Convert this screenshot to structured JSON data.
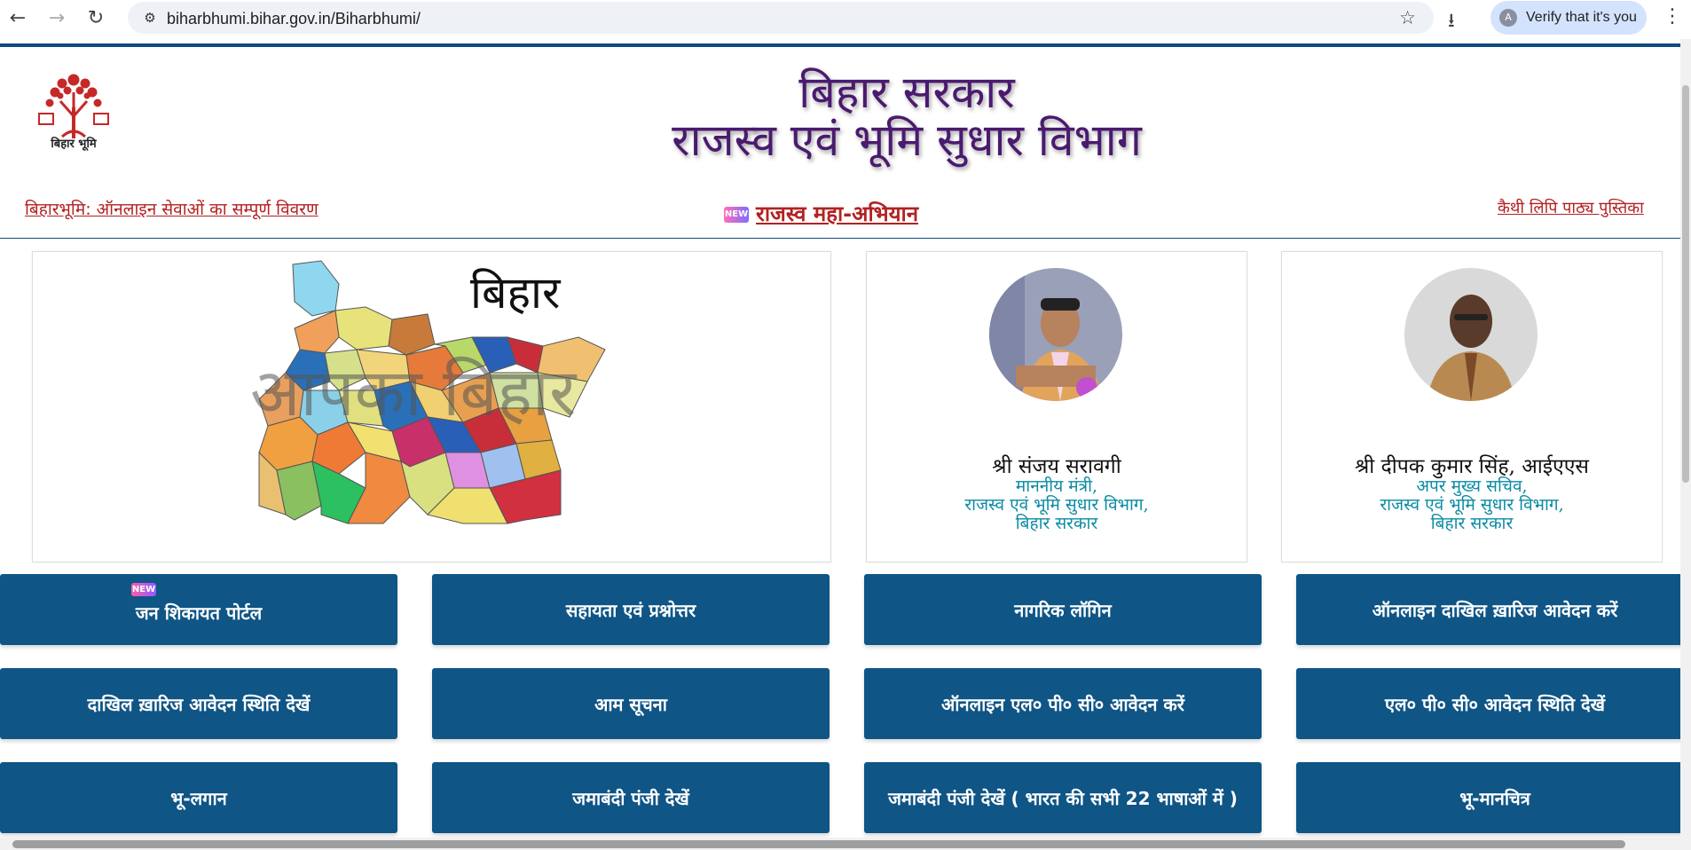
{
  "browser": {
    "url": "biharbhumi.bihar.gov.in/Biharbhumi/",
    "verify_label": "Verify that it's you",
    "avatar_letter": "A"
  },
  "header": {
    "logo_text": "बिहार भूमि",
    "title_line1": "बिहार सरकार",
    "title_line2": "राजस्व एवं भूमि सुधार विभाग",
    "link_left": "बिहारभूमि: ऑनलाइन सेवाओं का सम्पूर्ण विवरण",
    "link_center": "राजस्व महा-अभियान",
    "link_right": "कैथी लिपि पाठ्य पुस्तिका",
    "new_badge": "NEW"
  },
  "map": {
    "title": "बिहार",
    "watermark": "आपका बिहार"
  },
  "people": [
    {
      "name": "श्री संजय सरावगी",
      "line1": "माननीय मंत्री,",
      "line2": "राजस्व एवं भूमि सुधार विभाग,",
      "line3": "बिहार सरकार"
    },
    {
      "name": "श्री दीपक कुमार सिंह, आईएएस",
      "line1": "अपर मुख्य सचिव,",
      "line2": "राजस्व एवं भूमि सुधार विभाग,",
      "line3": "बिहार सरकार"
    }
  ],
  "buttons": [
    {
      "label": "जन शिकायत पोर्टल",
      "badge": "NEW"
    },
    {
      "label": "सहायता एवं प्रश्नोत्तर"
    },
    {
      "label": "नागरिक लॉगिन"
    },
    {
      "label": "ऑनलाइन दाखिल ख़ारिज आवेदन करें"
    },
    {
      "label": "दाखिल ख़ारिज आवेदन स्थिति देखें"
    },
    {
      "label": "आम सूचना"
    },
    {
      "label": "ऑनलाइन एल० पी० सी० आवेदन करें"
    },
    {
      "label": "एल० पी० सी० आवेदन स्थिति देखें"
    },
    {
      "label": "भू-लगान"
    },
    {
      "label": "जमाबंदी पंजी देखें"
    },
    {
      "label": "जमाबंदी पंजी देखें ( भारत की सभी 22 भाषाओं में )"
    },
    {
      "label": "भू-मानचित्र"
    }
  ],
  "colors": {
    "button_bg": "#0f5586",
    "title": "#4a1a6f",
    "link": "#b22222",
    "designation": "#0b8ba3"
  }
}
